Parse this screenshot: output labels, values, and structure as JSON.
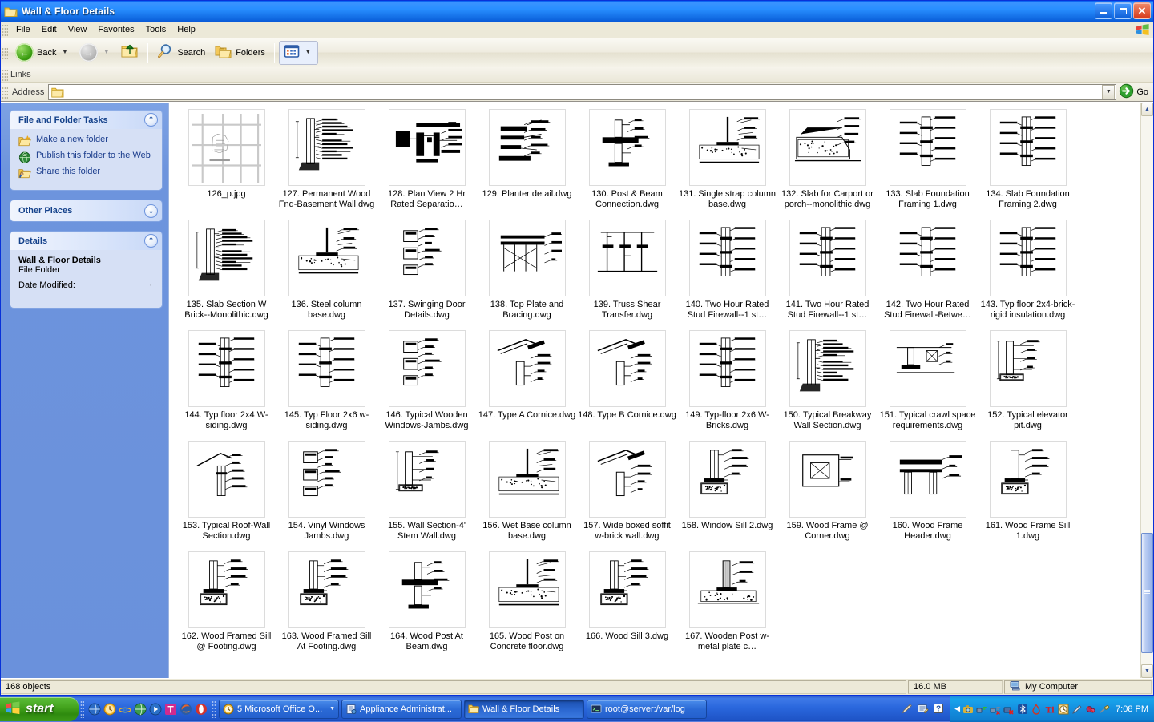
{
  "window": {
    "title": "Wall & Floor Details",
    "icon": "folder-icon",
    "minimize_label": "Minimize",
    "maximize_label": "Restore",
    "close_label": "Close"
  },
  "menu": {
    "items": [
      "File",
      "Edit",
      "View",
      "Favorites",
      "Tools",
      "Help"
    ]
  },
  "toolbar": {
    "back_label": "Back",
    "forward_label": "",
    "up_label": "Up",
    "search_label": "Search",
    "folders_label": "Folders",
    "views_label": "Views"
  },
  "links_bar": {
    "label": "Links"
  },
  "address_bar": {
    "label": "Address",
    "value": "",
    "go_label": "Go",
    "icon": "folder-icon"
  },
  "sidebar": {
    "panels": [
      {
        "title": "File and Folder Tasks",
        "state": "expanded",
        "chevron": "chevron-up-icon",
        "tasks": [
          {
            "label": "Make a new folder",
            "icon": "new-folder-icon"
          },
          {
            "label": "Publish this folder to the Web",
            "icon": "publish-web-icon"
          },
          {
            "label": "Share this folder",
            "icon": "share-folder-icon"
          }
        ]
      },
      {
        "title": "Other Places",
        "state": "collapsed",
        "chevron": "chevron-down-icon",
        "tasks": []
      },
      {
        "title": "Details",
        "state": "expanded",
        "chevron": "chevron-up-icon",
        "details": {
          "name": "Wall & Floor Details",
          "type": "File Folder",
          "date_modified_label": "Date Modified:",
          "date_modified_value": ""
        }
      }
    ]
  },
  "files": [
    {
      "name": "126_p.jpg",
      "thumb": "grid-sketch"
    },
    {
      "name": "127. Permanent Wood Fnd-Basement Wall.dwg",
      "thumb": "wall-section"
    },
    {
      "name": "128. Plan View 2 Hr Rated Separatio…",
      "thumb": "plan-view"
    },
    {
      "name": "129. Planter detail.dwg",
      "thumb": "planter"
    },
    {
      "name": "130. Post & Beam Connection.dwg",
      "thumb": "post-beam"
    },
    {
      "name": "131. Single strap column base.dwg",
      "thumb": "column-base"
    },
    {
      "name": "132. Slab for Carport or porch--monolithic.dwg",
      "thumb": "slab-mono"
    },
    {
      "name": "133. Slab Foundation Framing 1.dwg",
      "thumb": "slab-framing"
    },
    {
      "name": "134. Slab Foundation Framing 2.dwg",
      "thumb": "slab-framing"
    },
    {
      "name": "135. Slab Section W Brick--Monolithic.dwg",
      "thumb": "slab-brick"
    },
    {
      "name": "136. Steel column base.dwg",
      "thumb": "steel-col"
    },
    {
      "name": "137. Swinging Door Details.dwg",
      "thumb": "door-detail"
    },
    {
      "name": "138. Top Plate and Bracing.dwg",
      "thumb": "top-plate"
    },
    {
      "name": "139. Truss Shear Transfer.dwg",
      "thumb": "truss-shear"
    },
    {
      "name": "140. Two Hour Rated Stud Firewall--1 st…",
      "thumb": "firewall"
    },
    {
      "name": "141. Two Hour Rated Stud Firewall--1 st…",
      "thumb": "firewall"
    },
    {
      "name": "142. Two Hour Rated Stud Firewall-Betwe…",
      "thumb": "firewall"
    },
    {
      "name": "143. Typ floor 2x4-brick-rigid insulation.dwg",
      "thumb": "typ-floor"
    },
    {
      "name": "144. Typ floor 2x4 W-siding.dwg",
      "thumb": "typ-floor2"
    },
    {
      "name": "145. Typ Floor 2x6 w-siding.dwg",
      "thumb": "typ-floor2"
    },
    {
      "name": "146. Typical Wooden Windows-Jambs.dwg",
      "thumb": "window-jamb"
    },
    {
      "name": "147. Type A Cornice.dwg",
      "thumb": "cornice-a"
    },
    {
      "name": "148. Type B Cornice.dwg",
      "thumb": "cornice-b"
    },
    {
      "name": "149. Typ-floor 2x6 W-Bricks.dwg",
      "thumb": "typ-floor-brick"
    },
    {
      "name": "150. Typical Breakway Wall Section.dwg",
      "thumb": "breakaway"
    },
    {
      "name": "151. Typical crawl space requirements.dwg",
      "thumb": "crawl-space"
    },
    {
      "name": "152. Typical elevator pit.dwg",
      "thumb": "elevator-pit"
    },
    {
      "name": "153. Typical Roof-Wall Section.dwg",
      "thumb": "roof-wall"
    },
    {
      "name": "154. Vinyl Windows Jambs.dwg",
      "thumb": "vinyl-jamb"
    },
    {
      "name": "155. Wall Section-4' Stem Wall.dwg",
      "thumb": "stem-wall"
    },
    {
      "name": "156. Wet Base column base.dwg",
      "thumb": "wet-base"
    },
    {
      "name": "157. Wide boxed soffit w-brick wall.dwg",
      "thumb": "soffit"
    },
    {
      "name": "158. Window Sill 2.dwg",
      "thumb": "window-sill"
    },
    {
      "name": "159. Wood Frame @ Corner.dwg",
      "thumb": "frame-corner"
    },
    {
      "name": "160. Wood Frame Header.dwg",
      "thumb": "frame-header"
    },
    {
      "name": "161. Wood Frame Sill 1.dwg",
      "thumb": "frame-sill"
    },
    {
      "name": "162. Wood Framed Sill @ Footing.dwg",
      "thumb": "sill-footing"
    },
    {
      "name": "163. Wood Framed Sill At Footing.dwg",
      "thumb": "sill-footing2"
    },
    {
      "name": "164. Wood Post At Beam.dwg",
      "thumb": "post-at-beam"
    },
    {
      "name": "165. Wood Post on Concrete floor.dwg",
      "thumb": "post-concrete"
    },
    {
      "name": "166. Wood Sill 3.dwg",
      "thumb": "wood-sill3"
    },
    {
      "name": "167. Wooden Post w-metal plate c…",
      "thumb": "post-metal-plate"
    }
  ],
  "status_bar": {
    "object_count": "168 objects",
    "size": "16.0 MB",
    "location": "My Computer"
  },
  "taskbar": {
    "start_label": "start",
    "quick_launch": [
      "channels-icon",
      "clock-icon",
      "internet-explorer-icon",
      "browser-icon",
      "media-player-icon",
      "t-app-icon",
      "firefox-icon",
      "opera-icon"
    ],
    "tasks": [
      {
        "label": "5 Microsoft Office O...",
        "icon": "office-icon",
        "active": false,
        "has_dropdown": true
      },
      {
        "label": "Appliance Administrat...",
        "icon": "appliance-icon",
        "active": false,
        "has_dropdown": false
      },
      {
        "label": "Wall & Floor Details",
        "icon": "folder-icon",
        "active": true,
        "has_dropdown": false
      },
      {
        "label": "root@server:/var/log",
        "icon": "terminal-icon",
        "active": false,
        "has_dropdown": false
      }
    ],
    "notify_icons": [
      "pen-icon",
      "tablet-icon",
      "help-icon"
    ],
    "tray_chevron": "chevron-left-icon",
    "tray_icons": [
      "camera-icon",
      "network-active-icon",
      "network-disconnected-icon",
      "network-error-icon",
      "bluetooth-icon",
      "drop-icon",
      "ti-icon",
      "clock-tray-icon",
      "pen-tray-icon",
      "sound-muted-icon",
      "plug-icon"
    ],
    "clock": "7:08 PM"
  },
  "colors": {
    "title_blue": "#0058ee",
    "sidebar_blue": "#6d94dd",
    "panel_body": "#d6e0f5",
    "link_blue": "#1a3c8c",
    "chrome": "#ece9d8",
    "taskbar_blue": "#2a67dd",
    "start_green": "#45a51f"
  }
}
